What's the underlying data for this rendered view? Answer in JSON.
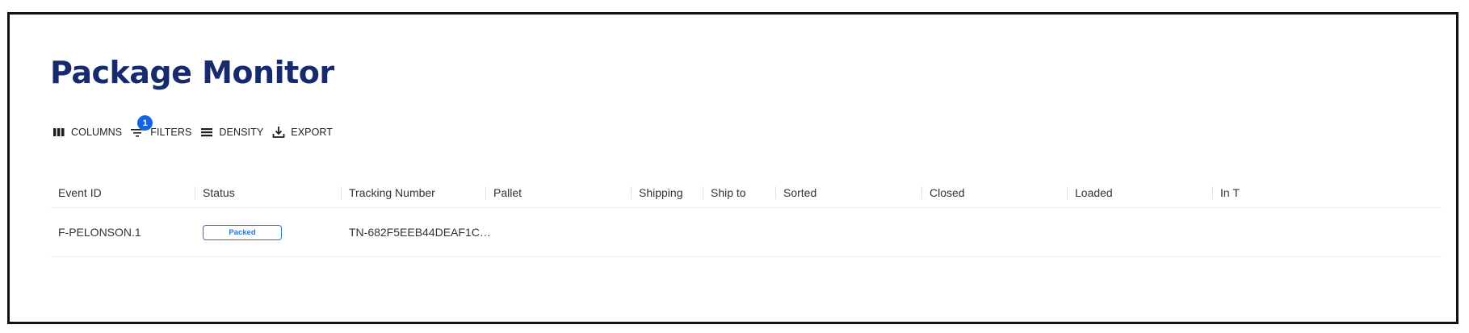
{
  "page": {
    "title": "Package Monitor"
  },
  "toolbar": {
    "columns_label": "COLUMNS",
    "filters_label": "FILTERS",
    "filters_count": "1",
    "density_label": "DENSITY",
    "export_label": "EXPORT",
    "icons": {
      "columns": "columns-icon",
      "filters": "filter-icon",
      "density": "density-icon",
      "export": "export-icon"
    }
  },
  "table": {
    "columns": [
      "Event ID",
      "Status",
      "Tracking Number",
      "Pallet",
      "Shipping",
      "Ship to",
      "Sorted",
      "Closed",
      "Loaded",
      "In T"
    ],
    "rows": [
      {
        "event_id": "F-PELONSON.1",
        "status": "Packed",
        "tracking_number": "TN-682F5EEB44DEAF1C…",
        "pallet": "",
        "shipping": "",
        "ship_to": "",
        "sorted": "",
        "closed": "",
        "loaded": "",
        "in_transit": ""
      }
    ]
  },
  "colors": {
    "title": "#172a6e",
    "accent": "#1565e0",
    "status_packed": "#2277dd"
  }
}
